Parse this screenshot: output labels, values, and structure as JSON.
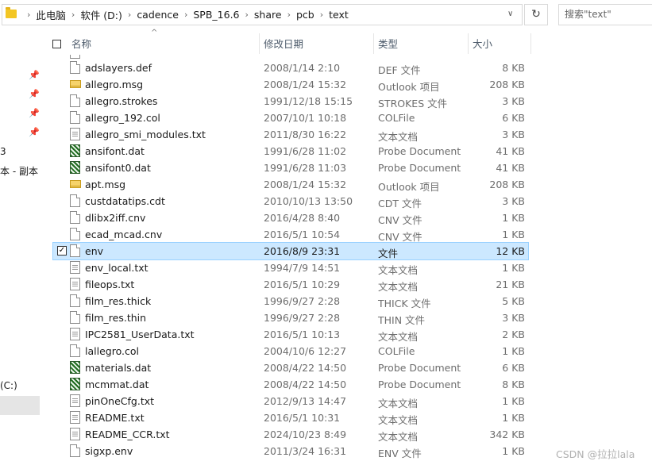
{
  "address": {
    "crumbs": [
      "此电脑",
      "软件 (D:)",
      "cadence",
      "SPB_16.6",
      "share",
      "pcb",
      "text"
    ],
    "sep": "›",
    "dropdown": "∨",
    "refresh": "↻",
    "search_placeholder": "搜索\"text\""
  },
  "nav": {
    "item1": "3",
    "item2": "本 - 副本",
    "item3": "(C:)"
  },
  "columns": {
    "name": "名称",
    "date": "修改日期",
    "type": "类型",
    "size": "大小",
    "sort_arrow": "^"
  },
  "files": [
    {
      "name": "adslayers.def",
      "date": "2008/1/14 2:10",
      "type": "DEF 文件",
      "size": "8 KB",
      "icon": "doc"
    },
    {
      "name": "allegro.msg",
      "date": "2008/1/24 15:32",
      "type": "Outlook 项目",
      "size": "208 KB",
      "icon": "msg"
    },
    {
      "name": "allegro.strokes",
      "date": "1991/12/18 15:15",
      "type": "STROKES 文件",
      "size": "3 KB",
      "icon": "doc"
    },
    {
      "name": "allegro_192.col",
      "date": "2007/10/1 10:18",
      "type": "COLFile",
      "size": "6 KB",
      "icon": "doc"
    },
    {
      "name": "allegro_smi_modules.txt",
      "date": "2011/8/30 16:22",
      "type": "文本文档",
      "size": "3 KB",
      "icon": "txt"
    },
    {
      "name": "ansifont.dat",
      "date": "1991/6/28 11:02",
      "type": "Probe Document",
      "size": "41 KB",
      "icon": "dat"
    },
    {
      "name": "ansifont0.dat",
      "date": "1991/6/28 11:03",
      "type": "Probe Document",
      "size": "41 KB",
      "icon": "dat"
    },
    {
      "name": "apt.msg",
      "date": "2008/1/24 15:32",
      "type": "Outlook 项目",
      "size": "208 KB",
      "icon": "msg"
    },
    {
      "name": "custdatatips.cdt",
      "date": "2010/10/13 13:50",
      "type": "CDT 文件",
      "size": "3 KB",
      "icon": "doc"
    },
    {
      "name": "dlibx2iff.cnv",
      "date": "2016/4/28 8:40",
      "type": "CNV 文件",
      "size": "1 KB",
      "icon": "doc"
    },
    {
      "name": "ecad_mcad.cnv",
      "date": "2016/5/1 10:54",
      "type": "CNV 文件",
      "size": "1 KB",
      "icon": "doc"
    },
    {
      "name": "env",
      "date": "2016/8/9 23:31",
      "type": "文件",
      "size": "12 KB",
      "icon": "doc",
      "selected": true
    },
    {
      "name": "env_local.txt",
      "date": "1994/7/9 14:51",
      "type": "文本文档",
      "size": "1 KB",
      "icon": "txt"
    },
    {
      "name": "fileops.txt",
      "date": "2016/5/1 10:29",
      "type": "文本文档",
      "size": "21 KB",
      "icon": "txt"
    },
    {
      "name": "film_res.thick",
      "date": "1996/9/27 2:28",
      "type": "THICK 文件",
      "size": "5 KB",
      "icon": "doc"
    },
    {
      "name": "film_res.thin",
      "date": "1996/9/27 2:28",
      "type": "THIN 文件",
      "size": "3 KB",
      "icon": "doc"
    },
    {
      "name": "IPC2581_UserData.txt",
      "date": "2016/5/1 10:13",
      "type": "文本文档",
      "size": "2 KB",
      "icon": "txt"
    },
    {
      "name": "lallegro.col",
      "date": "2004/10/6 12:27",
      "type": "COLFile",
      "size": "1 KB",
      "icon": "doc"
    },
    {
      "name": "materials.dat",
      "date": "2008/4/22 14:50",
      "type": "Probe Document",
      "size": "6 KB",
      "icon": "dat"
    },
    {
      "name": "mcmmat.dat",
      "date": "2008/4/22 14:50",
      "type": "Probe Document",
      "size": "8 KB",
      "icon": "dat"
    },
    {
      "name": "pinOneCfg.txt",
      "date": "2012/9/13 14:47",
      "type": "文本文档",
      "size": "1 KB",
      "icon": "txt"
    },
    {
      "name": "README.txt",
      "date": "2016/5/1 10:31",
      "type": "文本文档",
      "size": "1 KB",
      "icon": "txt"
    },
    {
      "name": "README_CCR.txt",
      "date": "2024/10/23 8:49",
      "type": "文本文档",
      "size": "342 KB",
      "icon": "txt"
    },
    {
      "name": "sigxp.env",
      "date": "2011/3/24 16:31",
      "type": "ENV 文件",
      "size": "1 KB",
      "icon": "doc"
    }
  ],
  "watermark": "CSDN @拉拉lala"
}
